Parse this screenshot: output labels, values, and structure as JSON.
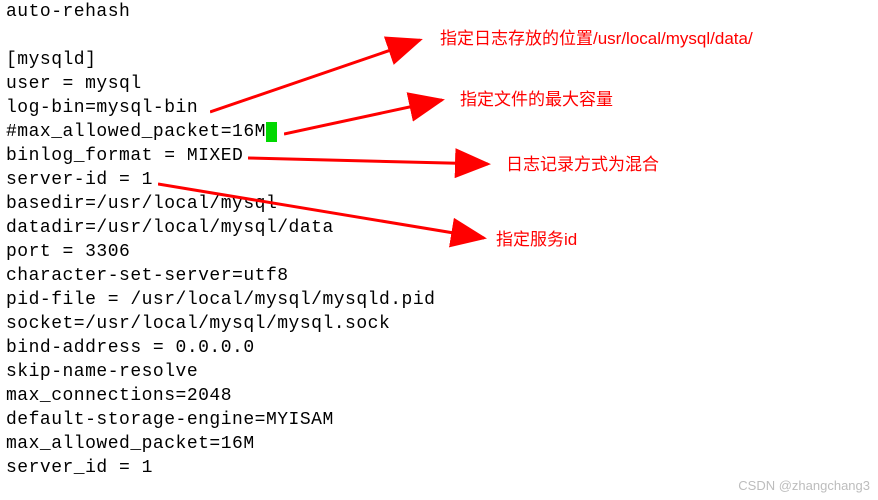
{
  "config": {
    "line1": "auto-rehash",
    "line2": "",
    "line3": "[mysqld]",
    "line4": "user = mysql",
    "line5": "log-bin=mysql-bin",
    "line6_pre": "#max_allowed_packet=16M",
    "line7": "binlog_format = MIXED",
    "line8": "server-id = 1",
    "line9": "basedir=/usr/local/mysql",
    "line10": "datadir=/usr/local/mysql/data",
    "line11": "port = 3306",
    "line12": "character-set-server=utf8",
    "line13": "pid-file = /usr/local/mysql/mysqld.pid",
    "line14": "socket=/usr/local/mysql/mysql.sock",
    "line15": "bind-address = 0.0.0.0",
    "line16": "skip-name-resolve",
    "line17": "max_connections=2048",
    "line18": "default-storage-engine=MYISAM",
    "line19": "max_allowed_packet=16M",
    "line20": "server_id = 1"
  },
  "annotations": {
    "a1": "指定日志存放的位置/usr/local/mysql/data/",
    "a2": "指定文件的最大容量",
    "a3": "日志记录方式为混合",
    "a4": "指定服务id"
  },
  "watermark": "CSDN @zhangchang3"
}
